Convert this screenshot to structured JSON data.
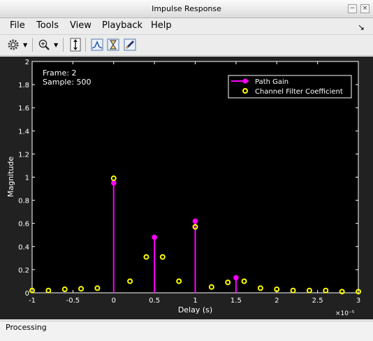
{
  "window": {
    "title": "Impulse Response"
  },
  "menu": {
    "file": "File",
    "tools": "Tools",
    "view": "View",
    "playback": "Playback",
    "help": "Help"
  },
  "toolbar": {
    "icons": [
      "gear-icon",
      "dropdown-arrow-icon",
      "zoom-in-icon",
      "dropdown-arrow-icon",
      "autoscale-vertical-icon",
      "spectrum-icon",
      "hourglass-icon",
      "edit-pencil-icon"
    ]
  },
  "plot": {
    "frame_text": "Frame: 2",
    "sample_text": "Sample: 500",
    "exponent_label": "×10⁻⁵",
    "colors": {
      "background": "#000000",
      "panel": "#212121",
      "axis": "#ffffff",
      "path_gain": "#ff00ff",
      "filter_coef": "#ffff00"
    }
  },
  "chart_data": {
    "type": "scatter",
    "xlabel": "Delay (s)",
    "ylabel": "Magnitude",
    "xlim": [
      -1,
      3
    ],
    "ylim": [
      0,
      2
    ],
    "x_ticks": [
      "-1",
      "-0.5",
      "0",
      "0.5",
      "1",
      "1.5",
      "2",
      "2.5",
      "3"
    ],
    "y_ticks": [
      "0",
      "0.2",
      "0.4",
      "0.6",
      "0.8",
      "1",
      "1.2",
      "1.4",
      "1.6",
      "1.8",
      "2"
    ],
    "x_multiplier": "1e-5",
    "legend_position": "top-right",
    "grid": false,
    "series": [
      {
        "name": "Path Gain",
        "style": "stem",
        "color": "#ff00ff",
        "x": [
          0,
          0.5,
          1,
          1.5
        ],
        "y": [
          0.95,
          0.48,
          0.62,
          0.13
        ]
      },
      {
        "name": "Channel Filter Coefficient",
        "style": "markers",
        "color": "#ffff00",
        "x": [
          -1,
          -0.8,
          -0.6,
          -0.4,
          -0.2,
          0,
          0.2,
          0.4,
          0.6,
          0.8,
          1,
          1.2,
          1.4,
          1.6,
          1.8,
          2,
          2.2,
          2.4,
          2.6,
          2.8,
          3
        ],
        "y": [
          0.02,
          0.02,
          0.03,
          0.035,
          0.04,
          0.99,
          0.1,
          0.31,
          0.31,
          0.1,
          0.57,
          0.05,
          0.09,
          0.1,
          0.04,
          0.03,
          0.02,
          0.02,
          0.02,
          0.01,
          0.01
        ]
      }
    ]
  },
  "status": {
    "text": "Processing"
  }
}
